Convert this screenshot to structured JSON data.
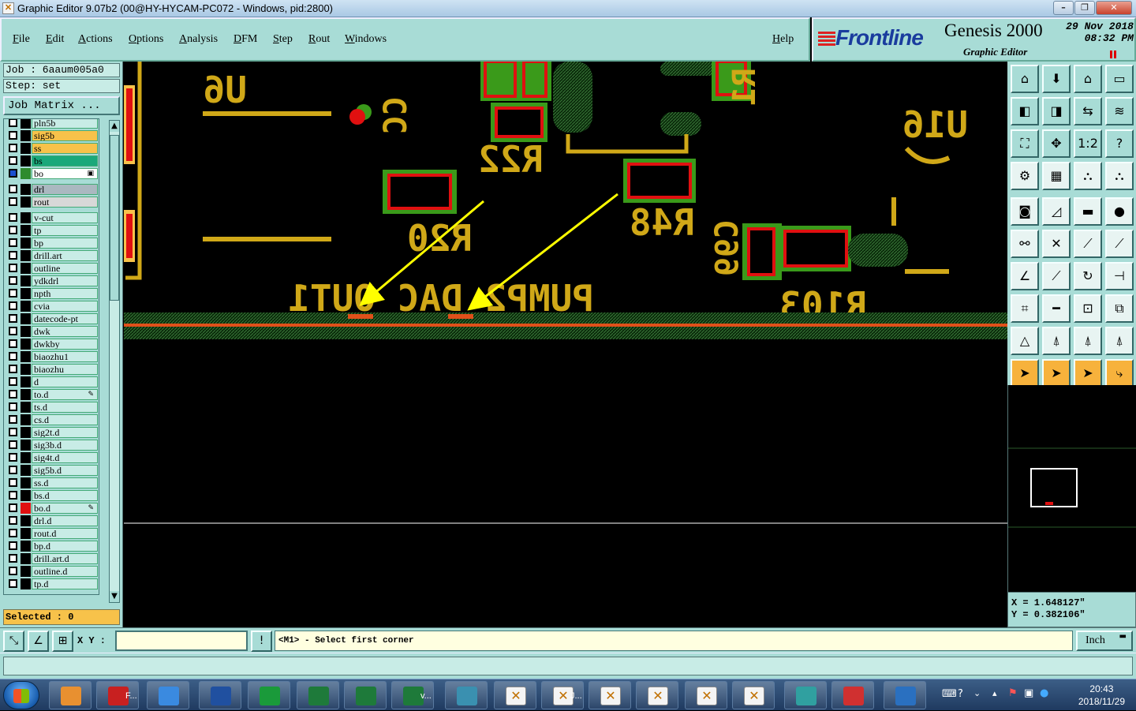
{
  "window": {
    "title": "Graphic Editor 9.07b2 (00@HY-HYCAM-PC072 - Windows, pid:2800)",
    "icon": "x-window-icon"
  },
  "menu": {
    "items": [
      "File",
      "Edit",
      "Actions",
      "Options",
      "Analysis",
      "DFM",
      "Step",
      "Rout",
      "Windows"
    ],
    "help": "Help"
  },
  "brand": {
    "logo": "Frontline",
    "product": "Genesis 2000",
    "subtitle": "Graphic Editor",
    "date_line1": "29 Nov 2018",
    "date_line2": "08:32 PM"
  },
  "job": {
    "job_line": "Job : 6aaum005a0",
    "step_line": "Step: set",
    "matrix_button": "Job Matrix ..."
  },
  "layers": [
    {
      "name": "pln5b",
      "bg": "#c8ece6",
      "color": "#000"
    },
    {
      "name": "sig5b",
      "bg": "#f7c24a",
      "color": "#000"
    },
    {
      "name": "ss",
      "bg": "#f7c24a",
      "color": "#000"
    },
    {
      "name": "bs",
      "bg": "#1aa87a",
      "color": "#000"
    },
    {
      "name": "bo",
      "bg": "#ffffff",
      "color": "#2e8b2e",
      "active": true
    },
    {
      "name": "drl",
      "bg": "#aab8c0",
      "color": "#000"
    },
    {
      "name": "rout",
      "bg": "#d8d8d8",
      "color": "#000"
    },
    {
      "name": "v-cut",
      "bg": "#c8ece6",
      "color": "#000"
    },
    {
      "name": "tp",
      "bg": "#c8ece6",
      "color": "#000"
    },
    {
      "name": "bp",
      "bg": "#c8ece6",
      "color": "#000"
    },
    {
      "name": "drill.art",
      "bg": "#c8ece6",
      "color": "#000"
    },
    {
      "name": "outline",
      "bg": "#c8ece6",
      "color": "#000"
    },
    {
      "name": "ydkdrl",
      "bg": "#c8ece6",
      "color": "#000"
    },
    {
      "name": "npth",
      "bg": "#c8ece6",
      "color": "#000"
    },
    {
      "name": "cvia",
      "bg": "#c8ece6",
      "color": "#000"
    },
    {
      "name": "datecode-pt",
      "bg": "#c8ece6",
      "color": "#000"
    },
    {
      "name": "dwk",
      "bg": "#c8ece6",
      "color": "#000"
    },
    {
      "name": "dwkby",
      "bg": "#c8ece6",
      "color": "#000"
    },
    {
      "name": "biaozhu1",
      "bg": "#c8ece6",
      "color": "#000"
    },
    {
      "name": "biaozhu",
      "bg": "#c8ece6",
      "color": "#000"
    },
    {
      "name": "d",
      "bg": "#c8ece6",
      "color": "#000"
    },
    {
      "name": "to.d",
      "bg": "#c8ece6",
      "color": "#000",
      "mark": "✎"
    },
    {
      "name": "ts.d",
      "bg": "#c8ece6",
      "color": "#000"
    },
    {
      "name": "cs.d",
      "bg": "#c8ece6",
      "color": "#000"
    },
    {
      "name": "sig2t.d",
      "bg": "#c8ece6",
      "color": "#000"
    },
    {
      "name": "sig3b.d",
      "bg": "#c8ece6",
      "color": "#000"
    },
    {
      "name": "sig4t.d",
      "bg": "#c8ece6",
      "color": "#000"
    },
    {
      "name": "sig5b.d",
      "bg": "#c8ece6",
      "color": "#000"
    },
    {
      "name": "ss.d",
      "bg": "#c8ece6",
      "color": "#000"
    },
    {
      "name": "bs.d",
      "bg": "#c8ece6",
      "color": "#000"
    },
    {
      "name": "bo.d",
      "bg": "#c8ece6",
      "color": "#e01010",
      "mark": "✎"
    },
    {
      "name": "drl.d",
      "bg": "#c8ece6",
      "color": "#000"
    },
    {
      "name": "rout.d",
      "bg": "#c8ece6",
      "color": "#000"
    },
    {
      "name": "bp.d",
      "bg": "#c8ece6",
      "color": "#000"
    },
    {
      "name": "drill.art.d",
      "bg": "#c8ece6",
      "color": "#000"
    },
    {
      "name": "outline.d",
      "bg": "#c8ece6",
      "color": "#000"
    },
    {
      "name": "tp.d",
      "bg": "#c8ece6",
      "color": "#000"
    }
  ],
  "selected": "Selected : 0",
  "canvas": {
    "labels": [
      "U6",
      "R22",
      "R20",
      "R48",
      "C99",
      "R103",
      "U16",
      "PUMP2_DAC_OUT1"
    ],
    "colors": {
      "silk": "#d0a818",
      "pad_red": "#e01010",
      "pad_green": "#3a9a1a",
      "arrow": "#ffff00",
      "strip": "#e0501a"
    }
  },
  "toolbox": [
    {
      "name": "home-icon",
      "glyph": "⌂"
    },
    {
      "name": "zoom-down-icon",
      "glyph": "⬇"
    },
    {
      "name": "house-icon",
      "glyph": "⌂"
    },
    {
      "name": "window-icon",
      "glyph": "▭"
    },
    {
      "name": "pan-left-icon",
      "glyph": "◧"
    },
    {
      "name": "pan-right-icon",
      "glyph": "◨"
    },
    {
      "name": "swap-icon",
      "glyph": "⇆"
    },
    {
      "name": "wave-icon",
      "glyph": "≋"
    },
    {
      "name": "fit-icon",
      "glyph": "⛶"
    },
    {
      "name": "center-icon",
      "glyph": "✥"
    },
    {
      "name": "scale-icon",
      "glyph": "1:2"
    },
    {
      "name": "help-icon",
      "glyph": "?"
    },
    {
      "name": "measure-icon",
      "glyph": "⚙"
    },
    {
      "name": "grid-icon",
      "glyph": "▦"
    },
    {
      "name": "layer-icon",
      "glyph": "⛬"
    },
    {
      "name": "layer-alt-icon",
      "glyph": "⛬"
    },
    {
      "name": "snap-icon",
      "glyph": "◙"
    },
    {
      "name": "angle-icon",
      "glyph": "◿"
    },
    {
      "name": "ruler-icon",
      "glyph": "▬"
    },
    {
      "name": "pad-icon",
      "glyph": "●"
    },
    {
      "name": "net-icon",
      "glyph": "⚯"
    },
    {
      "name": "cross-icon",
      "glyph": "✕"
    },
    {
      "name": "connect-icon",
      "glyph": "⟋"
    },
    {
      "name": "connect-alt-icon",
      "glyph": "⟋"
    },
    {
      "name": "line-icon",
      "glyph": "∠"
    },
    {
      "name": "diag-icon",
      "glyph": "⟋"
    },
    {
      "name": "arc-icon",
      "glyph": "↻"
    },
    {
      "name": "fork-icon",
      "glyph": "⊣"
    },
    {
      "name": "node-icon",
      "glyph": "⌗"
    },
    {
      "name": "bar-icon",
      "glyph": "━"
    },
    {
      "name": "box-icon",
      "glyph": "⊡"
    },
    {
      "name": "group-icon",
      "glyph": "⧉"
    },
    {
      "name": "triangle-icon",
      "glyph": "△"
    },
    {
      "name": "triangle-a-icon",
      "glyph": "⍋"
    },
    {
      "name": "triangle-b-icon",
      "glyph": "⍋"
    },
    {
      "name": "triangle-c-icon",
      "glyph": "⍋"
    },
    {
      "name": "pointer-icon",
      "glyph": "➤"
    },
    {
      "name": "pointer-box-icon",
      "glyph": "➤"
    },
    {
      "name": "pointer-circle-icon",
      "glyph": "➤"
    },
    {
      "name": "route-icon",
      "glyph": "⤷"
    }
  ],
  "coords": {
    "x": "X = 1.648127\"",
    "y": "Y = 0.382106\""
  },
  "statusbar": {
    "xy_label": "X Y :",
    "xy_value": "",
    "prompt": "<M1> - Select first corner",
    "units": "Inch"
  },
  "taskbar": {
    "buttons": [
      {
        "name": "shell-app-button",
        "label": ""
      },
      {
        "name": "frontline-app-button",
        "label": "F..."
      },
      {
        "name": "ie-app-button",
        "label": ""
      },
      {
        "name": "save-app-button",
        "label": ""
      },
      {
        "name": "genesis-app-button",
        "label": ""
      },
      {
        "name": "excel-app-button-1",
        "label": ""
      },
      {
        "name": "excel-app-button-2",
        "label": ""
      },
      {
        "name": "excel-app-button-3",
        "label": "v..."
      },
      {
        "name": "eye-app-button",
        "label": ""
      },
      {
        "name": "x-app-button-1",
        "label": ""
      },
      {
        "name": "x-app-button-2",
        "label": "J..."
      },
      {
        "name": "x-app-button-3",
        "label": ""
      },
      {
        "name": "x-app-button-4",
        "label": ""
      },
      {
        "name": "x-app-button-5",
        "label": ""
      },
      {
        "name": "x-app-button-6",
        "label": ""
      },
      {
        "name": "network-app-button",
        "label": ""
      },
      {
        "name": "pdf-app-button",
        "label": ""
      },
      {
        "name": "bird-app-button",
        "label": ""
      }
    ],
    "clock_time": "20:43",
    "clock_date": "2018/11/29"
  }
}
